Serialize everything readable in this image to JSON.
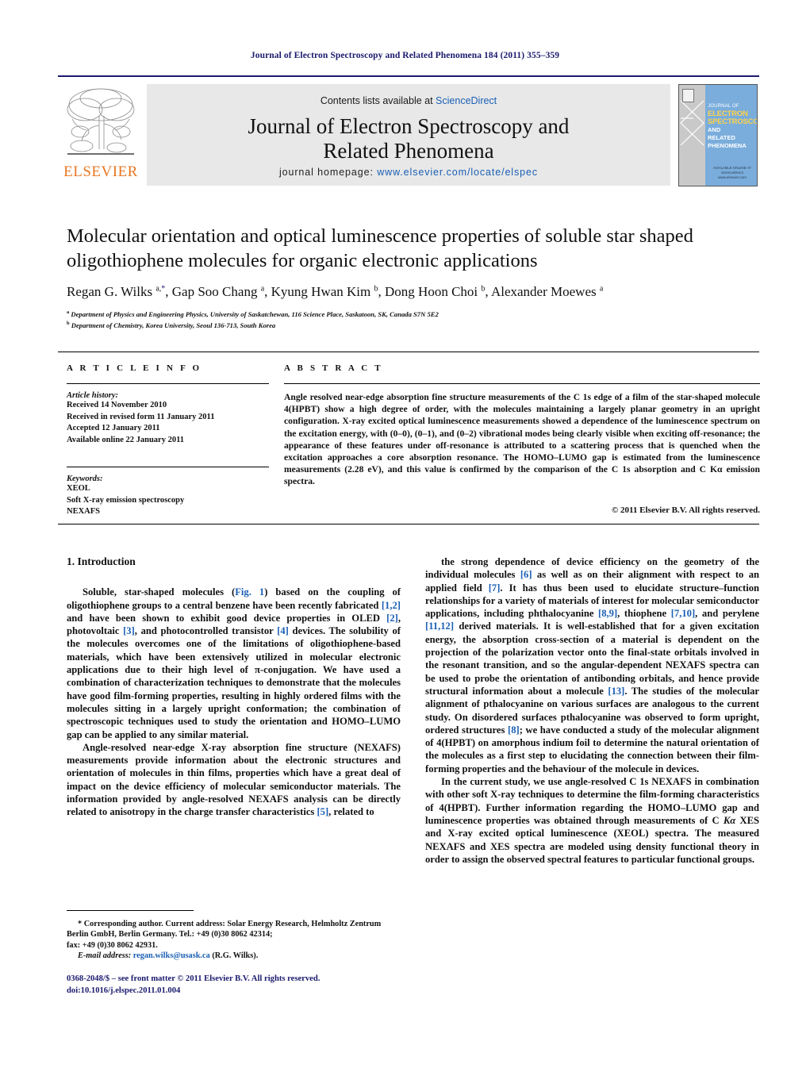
{
  "running_head": "Journal of Electron Spectroscopy and Related Phenomena 184 (2011) 355–359",
  "masthead": {
    "contents_prefix": "Contents lists available at ",
    "contents_link": "ScienceDirect",
    "journal_title_line1": "Journal of Electron Spectroscopy and",
    "journal_title_line2": "Related Phenomena",
    "homepage_label": "journal homepage: ",
    "homepage_url": "www.elsevier.com/locate/elspec",
    "publisher_wordmark": "ELSEVIER",
    "publisher_logo_icon": "elsevier-tree-logo"
  },
  "cover": {
    "line_journal": "JOURNAL OF",
    "line_electron": "ELECTRON",
    "line_spectroscopy": "SPECTROSCOPY",
    "line_and": "AND",
    "line_related": "RELATED PHENOMENA",
    "footer_line1": "AVAILABLE ONLINE AT",
    "footer_line2": "ScienceDirect",
    "footer_line3": "www.elsevier.com"
  },
  "article": {
    "title": "Molecular orientation and optical luminescence properties of soluble star shaped oligothiophene molecules for organic electronic applications",
    "authors_html": "Regan G. Wilks <sup>a,<span class=\"star\">*</span></sup>, Gap Soo Chang <sup>a</sup>, Kyung Hwan Kim <sup>b</sup>, Dong Hoon Choi <sup>b</sup>, Alexander Moewes <sup>a</sup>",
    "affiliation_a": "Department of Physics and Engineering Physics, University of Saskatchewan, 116 Science Place, Saskatoon, SK, Canada S7N 5E2",
    "affiliation_b": "Department of Chemistry, Korea University, Seoul 136-713, South Korea"
  },
  "article_info": {
    "heading": "A R T I C L E  I N F O",
    "history_title": "Article history:",
    "history": [
      "Received 14 November 2010",
      "Received in revised form 11 January 2011",
      "Accepted 12 January 2011",
      "Available online 22 January 2011"
    ],
    "keywords_title": "Keywords:",
    "keywords": [
      "XEOL",
      "Soft X-ray emission spectroscopy",
      "NEXAFS"
    ]
  },
  "abstract": {
    "heading": "A B S T R A C T",
    "text": "Angle resolved near-edge absorption fine structure measurements of the C 1s edge of a film of the star-shaped molecule 4(HPBT) show a high degree of order, with the molecules maintaining a largely planar geometry in an upright configuration. X-ray excited optical luminescence measurements showed a dependence of the luminescence spectrum on the excitation energy, with (0–0), (0–1), and (0–2) vibrational modes being clearly visible when exciting off-resonance; the appearance of these features under off-resonance is attributed to a scattering process that is quenched when the excitation approaches a core absorption resonance. The HOMO–LUMO gap is estimated from the luminescence measurements (2.28 eV), and this value is confirmed by the comparison of the C 1s absorption and C Kα emission spectra.",
    "copyright": "© 2011 Elsevier B.V. All rights reserved."
  },
  "body": {
    "section_heading": "1.  Introduction",
    "left_paragraphs_html": [
      "Soluble, star-shaped molecules (<span class=\"figref\">Fig. 1</span>) based on the coupling of oligothiophene groups to a central benzene have been recently fabricated <span class=\"ref\">[1,2]</span> and have been shown to exhibit good device properties in OLED <span class=\"ref\">[2]</span>, photovoltaic <span class=\"ref\">[3]</span>, and photocontrolled transistor <span class=\"ref\">[4]</span> devices. The solubility of the molecules overcomes one of the limitations of oligothiophene-based materials, which have been extensively utilized in molecular electronic applications due to their high level of π-conjugation. We have used a combination of characterization techniques to demonstrate that the molecules have good film-forming properties, resulting in highly ordered films with the molecules sitting in a largely upright conformation; the combination of spectroscopic techniques used to study the orientation and HOMO–LUMO gap can be applied to any similar material.",
      "Angle-resolved near-edge X-ray absorption fine structure (NEXAFS) measurements provide information about the electronic structures and orientation of molecules in thin films, properties which have a great deal of impact on the device efficiency of molecular semiconductor materials. The information provided by angle-resolved NEXAFS analysis can be directly related to anisotropy in the charge transfer characteristics <span class=\"ref\">[5]</span>, related to"
    ],
    "right_paragraphs_html": [
      "the strong dependence of device efficiency on the geometry of the individual molecules <span class=\"ref\">[6]</span> as well as on their alignment with respect to an applied field <span class=\"ref\">[7]</span>. It has thus been used to elucidate structure–function relationships for a variety of materials of interest for molecular semiconductor applications, including phthalocyanine <span class=\"ref\">[8,9]</span>, thiophene <span class=\"ref\">[7,10]</span>, and perylene <span class=\"ref\">[11,12]</span> derived materials. It is well-established that for a given excitation energy, the absorption cross-section of a material is dependent on the projection of the polarization vector onto the final-state orbitals involved in the resonant transition, and so the angular-dependent NEXAFS spectra can be used to probe the orientation of antibonding orbitals, and hence provide structural information about a molecule <span class=\"ref\">[13]</span>. The studies of the molecular alignment of pthalocyanine on various surfaces are analogous to the current study. On disordered surfaces pthalocyanine was observed to form upright, ordered structures <span class=\"ref\">[8]</span>; we have conducted a study of the molecular alignment of 4(HPBT) on amorphous indium foil to determine the natural orientation of the molecules as a first step to elucidating the connection between their film-forming properties and the behaviour of the molecule in devices.",
      "In the current study, we use angle-resolved C 1s NEXAFS in combination with other soft X-ray techniques to determine the film-forming characteristics of 4(HPBT). Further information regarding the HOMO–LUMO gap and luminescence properties was obtained through measurements of C <span style=\"font-style:italic\">Kα</span> XES and X-ray excited optical luminescence (XEOL) spectra. The measured NEXAFS and XES spectra are modeled using density functional theory in order to assign the observed spectral features to particular functional groups."
    ]
  },
  "footnote": {
    "corresponding_html": "* Corresponding author. Current address: Solar Energy Research, Helmholtz Zentrum Berlin GmbH, Berlin Germany. Tel.: +49 (0)30 8062 42314;",
    "fax_line": "fax: +49 (0)30 8062 42931.",
    "email_label": "E-mail address:",
    "email": "regan.wilks@usask.ca",
    "email_suffix": "(R.G. Wilks)."
  },
  "imprint": {
    "line1": "0368-2048/$ – see front matter © 2011 Elsevier B.V. All rights reserved.",
    "line2": "doi:10.1016/j.elspec.2011.01.004"
  }
}
